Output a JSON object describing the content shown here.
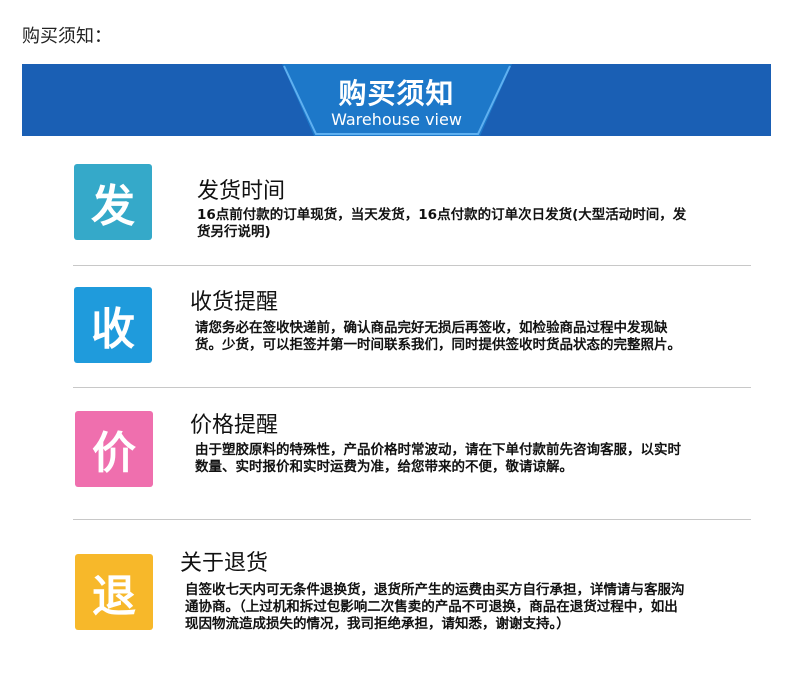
{
  "page_label": "购买须知：",
  "banner": {
    "title": "购买须知",
    "subtitle": "Warehouse view",
    "color": "#1a5fb4"
  },
  "items": [
    {
      "badge": "发",
      "badge_color": "#35a9c9",
      "heading": "发货时间",
      "desc": "16点前付款的订单现货，当天发货，16点付款的订单次日发货(大型活动时间，发货另行说明)"
    },
    {
      "badge": "收",
      "badge_color": "#1f9bdc",
      "heading": "收货提醒",
      "desc": "请您务必在签收快递前，确认商品完好无损后再签收，如检验商品过程中发现缺货。少货，可以拒签并第一时间联系我们，同时提供签收时货品状态的完整照片。"
    },
    {
      "badge": "价",
      "badge_color": "#ef6fae",
      "heading": "价格提醒",
      "desc": "由于塑胶原料的特殊性，产品价格时常波动，请在下单付款前先咨询客服，以实时数量、实时报价和实时运费为准，给您带来的不便，敬请谅解。"
    },
    {
      "badge": "退",
      "badge_color": "#f7b82a",
      "heading": "关于退货",
      "desc": "自签收七天内可无条件退换货，退货所产生的运费由买方自行承担，详情请与客服沟通协商。（上过机和拆过包影响二次售卖的产品不可退换，商品在退货过程中，如出现因物流造成损失的情况，我司拒绝承担，请知悉，谢谢支持。）"
    }
  ]
}
